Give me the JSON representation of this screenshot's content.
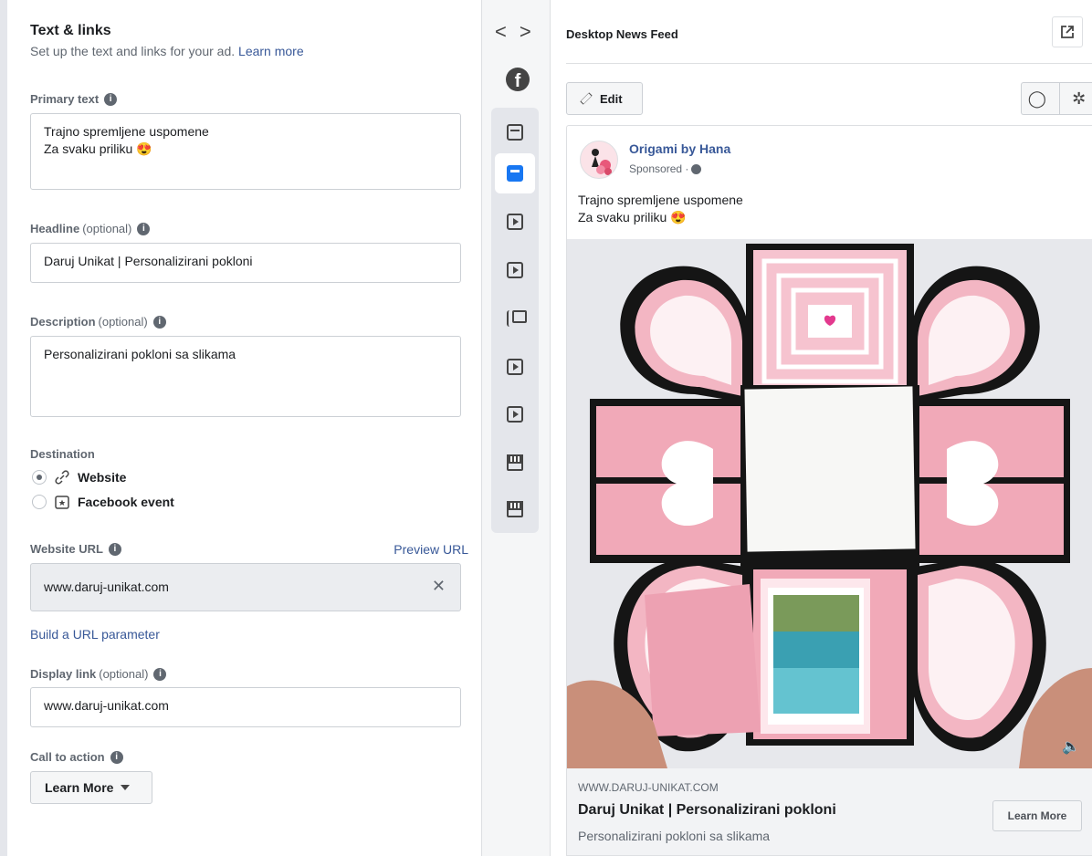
{
  "editor": {
    "section_title": "Text & links",
    "section_subtitle": "Set up the text and links for your ad.",
    "learn_more_link": "Learn more",
    "primary_text_label": "Primary text",
    "primary_text_value": "Trajno spremljene uspomene\nZa svaku priliku 😍",
    "headline_label": "Headline",
    "headline_optional": "(optional)",
    "headline_value": "Daruj Unikat | Personalizirani pokloni",
    "description_label": "Description",
    "description_optional": "(optional)",
    "description_value": "Personalizirani pokloni sa slikama",
    "destination_label": "Destination",
    "destination_options": [
      {
        "label": "Website",
        "selected": true,
        "icon": "link-icon"
      },
      {
        "label": "Facebook event",
        "selected": false,
        "icon": "event-icon"
      }
    ],
    "website_url_label": "Website URL",
    "preview_url_link": "Preview URL",
    "website_url_value": "www.daruj-unikat.com",
    "build_url_link": "Build a URL parameter",
    "display_link_label": "Display link",
    "display_link_optional": "(optional)",
    "display_link_value": "www.daruj-unikat.com",
    "cta_label": "Call to action",
    "cta_value": "Learn More"
  },
  "placements": {
    "nav_prev": "<",
    "nav_next": ">",
    "facebook_logo": "f",
    "items": [
      "feed-icon",
      "desktop-feed-icon",
      "video-icon",
      "video-icon",
      "stories-icon",
      "video-icon",
      "video-icon",
      "marketplace-icon",
      "marketplace-icon"
    ],
    "selected_index": 1,
    "accent": "#1877f2"
  },
  "preview": {
    "title": "Desktop News Feed",
    "edit_label": "Edit",
    "page_name": "Origami by Hana",
    "sponsored": "Sponsored ·",
    "primary_text": "Trajno spremljene uspomene\nZa svaku priliku 😍",
    "link_caption": "WWW.DARUJ-UNIKAT.COM",
    "headline": "Daruj Unikat | Personalizirani pokloni",
    "description": "Personalizirani pokloni sa slikama",
    "cta_button": "Learn More"
  },
  "colors": {
    "link": "#385898",
    "muted": "#606770",
    "paper_pink": "#f2a7b8",
    "paper_black": "#151515"
  }
}
